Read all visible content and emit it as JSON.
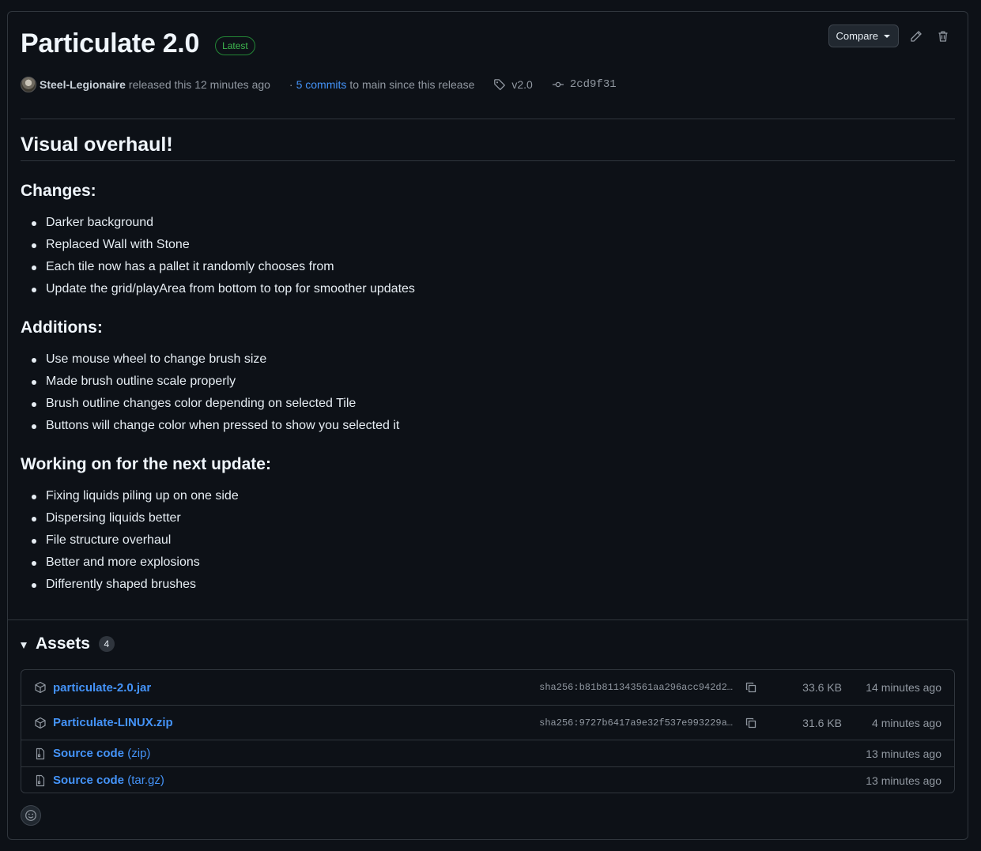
{
  "release": {
    "title": "Particulate 2.0",
    "badge": "Latest",
    "author": "Steel-Legionaire",
    "released_text": "released this 12 minutes ago",
    "commits_prefix": "·",
    "commits_link": "5 commits",
    "commits_suffix": "to main since this release",
    "tag": "v2.0",
    "commit_sha": "2cd9f31"
  },
  "toolbar": {
    "compare_label": "Compare",
    "edit_icon": "pencil-icon",
    "delete_icon": "trash-icon"
  },
  "body": {
    "heading": "Visual overhaul!",
    "changes_title": "Changes:",
    "changes": [
      "Darker background",
      "Replaced Wall with Stone",
      "Each tile now has a pallet it randomly chooses from",
      "Update the grid/playArea from bottom to top for smoother updates"
    ],
    "additions_title": "Additions:",
    "additions": [
      "Use mouse wheel to change brush size",
      "Made brush outline scale properly",
      "Brush outline changes color depending on selected Tile",
      "Buttons will change color when pressed to show you selected it"
    ],
    "next_title": "Working on for the next update:",
    "next": [
      "Fixing liquids piling up on one side",
      "Dispersing liquids better",
      "File structure overhaul",
      "Better and more explosions",
      "Differently shaped brushes"
    ]
  },
  "assets": {
    "title": "Assets",
    "count": "4",
    "items": [
      {
        "name": "particulate-2.0.jar",
        "sha": "sha256:b81b811343561aa296acc942d2…",
        "size": "33.6 KB",
        "time": "14 minutes ago",
        "icon": "package-icon"
      },
      {
        "name": "Particulate-LINUX.zip",
        "sha": "sha256:9727b6417a9e32f537e993229a…",
        "size": "31.6 KB",
        "time": "4 minutes ago",
        "icon": "package-icon"
      },
      {
        "name": "Source code",
        "type": "(zip)",
        "time": "13 minutes ago",
        "icon": "file-zip-icon"
      },
      {
        "name": "Source code",
        "type": "(tar.gz)",
        "time": "13 minutes ago",
        "icon": "file-zip-icon"
      }
    ]
  },
  "colors": {
    "background": "#0d1117",
    "border": "#30363d",
    "link": "#4493f8",
    "badge_green": "#3fb950",
    "muted": "#9198a1"
  }
}
